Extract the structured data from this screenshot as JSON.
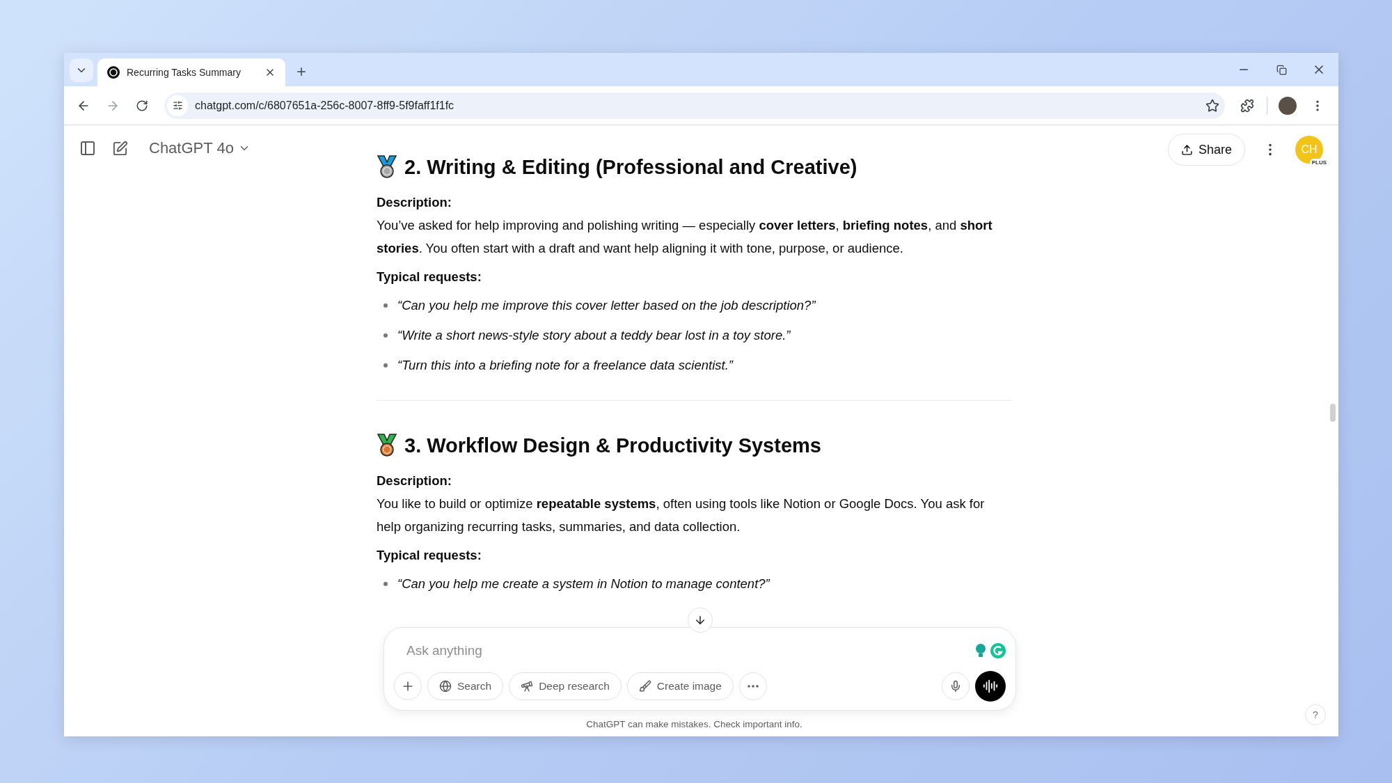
{
  "browser": {
    "tab": {
      "title": "Recurring Tasks Summary",
      "selected": true
    },
    "url": "chatgpt.com/c/6807651a-256c-8007-8ff9-5f9faff1f1fc"
  },
  "header": {
    "model": "ChatGPT 4o",
    "share": "Share",
    "avatar": {
      "initials": "CH",
      "badge": "PLUS"
    }
  },
  "sections": [
    {
      "kind": "silver",
      "title": "2. Writing & Editing (Professional and Creative)",
      "description_label": "Description:",
      "description": "You’ve asked for help improving and polishing writing — especially **cover letters**, **briefing notes**, and **short stories**. You often start with a draft and want help aligning it with tone, purpose, or audience.",
      "requests_label": "Typical requests:",
      "requests": [
        "“Can you help me improve this cover letter based on the job description?”",
        "“Write a short news-style story about a teddy bear lost in a toy store.”",
        "“Turn this into a briefing note for a freelance data scientist.”"
      ]
    },
    {
      "kind": "bronze",
      "title": "3. Workflow Design & Productivity Systems",
      "description_label": "Description:",
      "description": "You like to build or optimize **repeatable systems**, often using tools like Notion or Google Docs. You ask for help organizing recurring tasks, summaries, and data collection.",
      "requests_label": "Typical requests:",
      "requests": [
        "“Can you help me create a system in Notion to manage content?”"
      ]
    }
  ],
  "composer": {
    "placeholder": "Ask anything",
    "tools": [
      {
        "kind": "search",
        "label": "Search"
      },
      {
        "kind": "research",
        "label": "Deep research"
      },
      {
        "kind": "image",
        "label": "Create image"
      }
    ]
  },
  "disclaimer": "ChatGPT can make mistakes. Check important info.",
  "help": "?"
}
